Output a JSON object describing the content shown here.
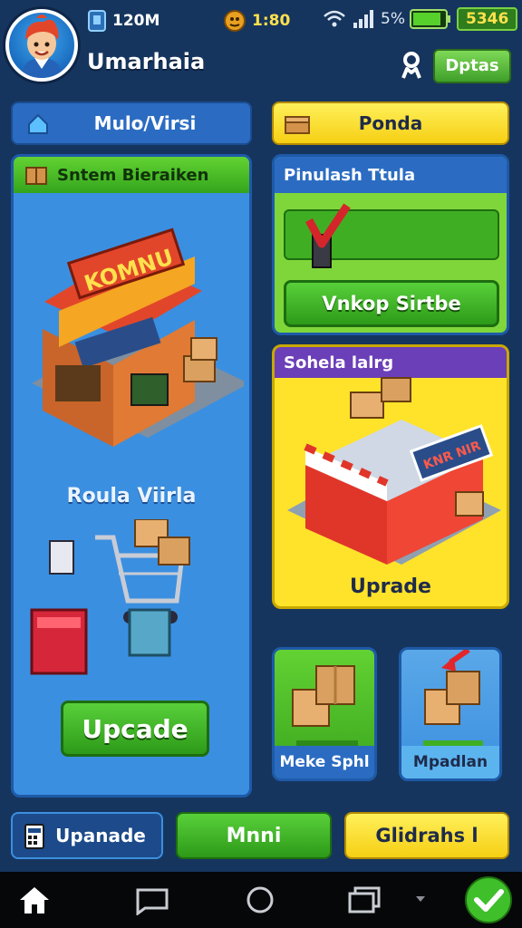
{
  "status": {
    "coins": "120M",
    "timer": "1:80",
    "signal_percent": "5%",
    "battery_value": "5346"
  },
  "header": {
    "player_name": "Umarhaia",
    "options_label": "Dptas"
  },
  "tabs": {
    "left_tab": "Mulo/Virsi",
    "right_tab": "Ponda"
  },
  "left_panel": {
    "title": "Sntem Bieraiken",
    "shop_sign": "KOMNU",
    "sub_heading": "Roula Viirla",
    "upgrade_button": "Upcade"
  },
  "right_top_panel": {
    "title": "Pinulash Ttula",
    "action_button": "Vnkop Sirtbe"
  },
  "right_mid_panel": {
    "title": "Sohela lalrg",
    "store_sign": "KNR NIR",
    "upgrade_label": "Uprade"
  },
  "small_cards": [
    {
      "label": "Meke Sphl"
    },
    {
      "label": "Mpadlan"
    }
  ],
  "bottom_bar": {
    "upgrade_button": "Upanade",
    "menu_button": "Mnni",
    "challenge_button": "Glidrahs l"
  },
  "colors": {
    "background": "#16355e",
    "accent_green": "#3fae23",
    "accent_yellow": "#ffe32a",
    "panel_blue": "#3b8fe0"
  }
}
